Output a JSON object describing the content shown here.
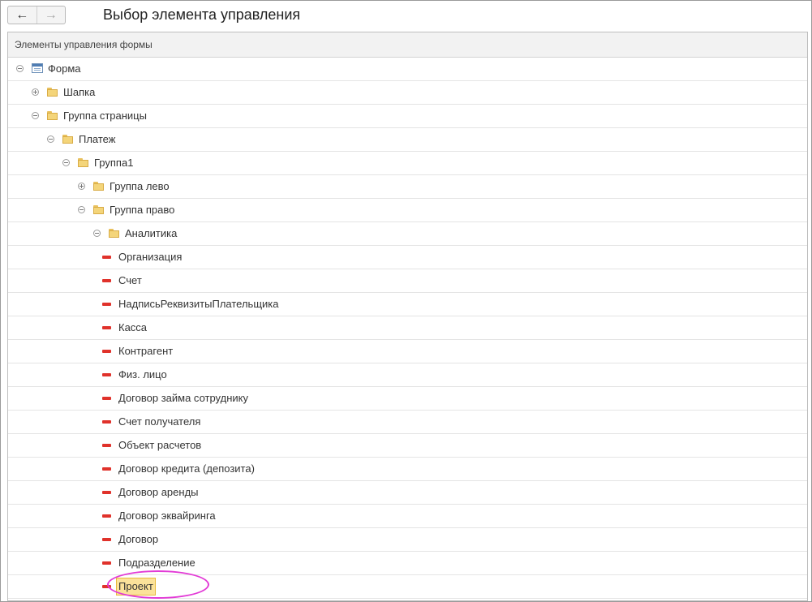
{
  "header": {
    "back_icon": "arrow-left-icon",
    "forward_icon": "arrow-right-icon",
    "title": "Выбор элемента управления"
  },
  "tree": {
    "column_header": "Элементы управления формы",
    "rows": [
      {
        "label": "Форма",
        "icon": "form-icon",
        "expander": "minus",
        "level": 0
      },
      {
        "label": "Шапка",
        "icon": "folder-icon",
        "expander": "plus",
        "level": 1
      },
      {
        "label": "Группа страницы",
        "icon": "folder-icon",
        "expander": "minus",
        "level": 1
      },
      {
        "label": "Платеж",
        "icon": "folder-icon",
        "expander": "minus",
        "level": 2
      },
      {
        "label": "Группа1",
        "icon": "folder-icon",
        "expander": "minus",
        "level": 3
      },
      {
        "label": "Группа лево",
        "icon": "folder-icon",
        "expander": "plus",
        "level": 4
      },
      {
        "label": "Группа право",
        "icon": "folder-icon",
        "expander": "minus",
        "level": 4
      },
      {
        "label": "Аналитика",
        "icon": "folder-icon",
        "expander": "minus",
        "level": 5
      },
      {
        "label": "Организация",
        "icon": "field-icon",
        "level": 6
      },
      {
        "label": "Счет",
        "icon": "field-icon",
        "level": 6
      },
      {
        "label": "НадписьРеквизитыПлательщика",
        "icon": "field-icon",
        "level": 6
      },
      {
        "label": "Касса",
        "icon": "field-icon",
        "level": 6
      },
      {
        "label": "Контрагент",
        "icon": "field-icon",
        "level": 6
      },
      {
        "label": "Физ. лицо",
        "icon": "field-icon",
        "level": 6
      },
      {
        "label": "Договор займа сотруднику",
        "icon": "field-icon",
        "level": 6
      },
      {
        "label": "Счет получателя",
        "icon": "field-icon",
        "level": 6
      },
      {
        "label": "Объект расчетов",
        "icon": "field-icon",
        "level": 6
      },
      {
        "label": "Договор кредита (депозита)",
        "icon": "field-icon",
        "level": 6
      },
      {
        "label": "Договор аренды",
        "icon": "field-icon",
        "level": 6
      },
      {
        "label": "Договор эквайринга",
        "icon": "field-icon",
        "level": 6
      },
      {
        "label": "Договор",
        "icon": "field-icon",
        "level": 6
      },
      {
        "label": "Подразделение",
        "icon": "field-icon",
        "level": 6
      },
      {
        "label": "Проект",
        "icon": "field-icon",
        "level": 6,
        "selected": true
      }
    ]
  },
  "colors": {
    "highlight_ellipse": "#e23ad6",
    "selection": "#fbe29a",
    "field_icon": "#e0322b"
  }
}
